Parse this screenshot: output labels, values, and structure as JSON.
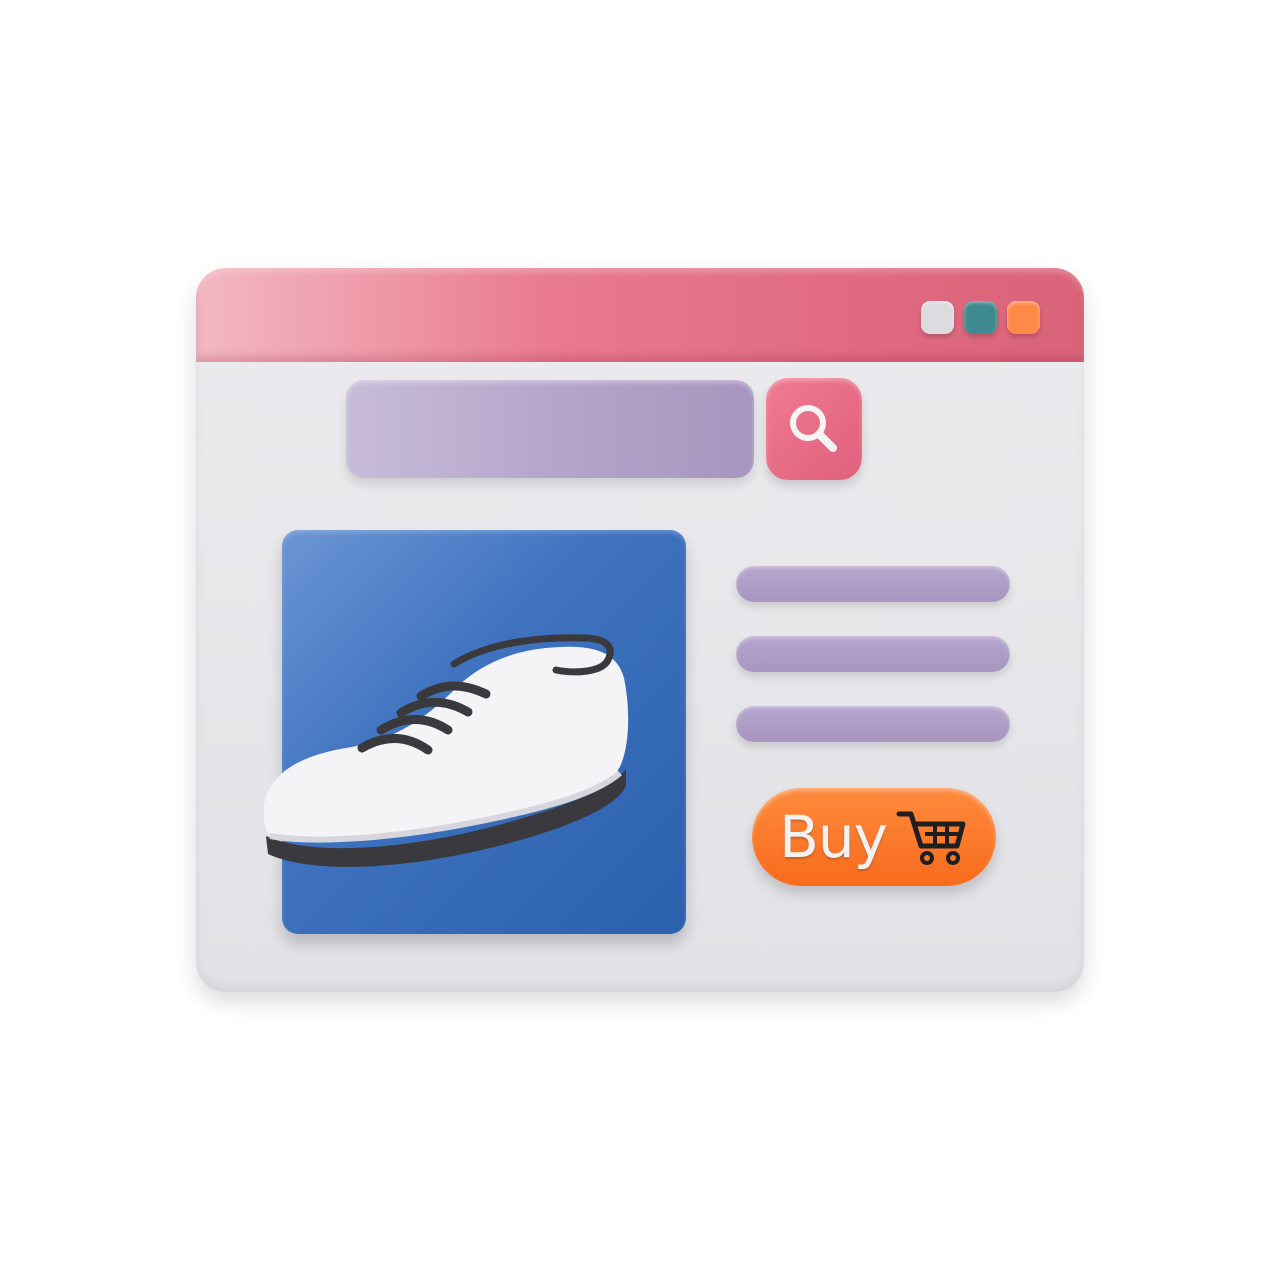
{
  "window": {
    "controls": [
      {
        "name": "control-light",
        "color": "#dcdce0"
      },
      {
        "name": "control-teal",
        "color": "#3f8a8e"
      },
      {
        "name": "control-orange",
        "color": "#ff8a48"
      }
    ],
    "titlebar_color": "#e97a8f"
  },
  "search": {
    "value": "",
    "placeholder": "",
    "button_icon": "search-icon"
  },
  "product": {
    "image_icon": "shoe-icon",
    "description_lines": 3
  },
  "buy_button": {
    "label": "Buy",
    "icon": "cart-icon",
    "color": "#f76b1c"
  }
}
